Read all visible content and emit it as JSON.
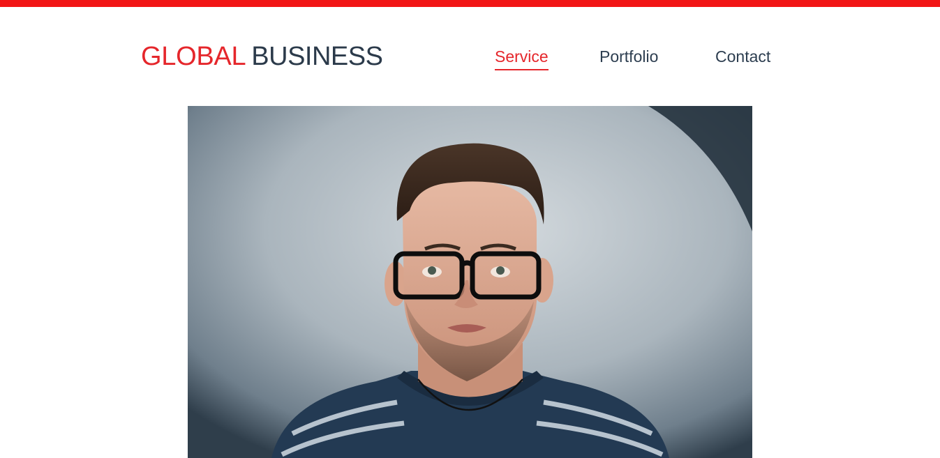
{
  "header": {
    "logo_light": "GLOBAL",
    "logo_strong": "BUSINESS",
    "nav": [
      {
        "label": "Service",
        "active": true
      },
      {
        "label": "Portfolio",
        "active": false
      },
      {
        "label": "Contact",
        "active": false
      }
    ]
  },
  "colors": {
    "accent": "#f21616",
    "brand_red": "#e5262b",
    "navy": "#2d3e50"
  },
  "hero": {
    "subject": "portrait of a young man with glasses and a striped navy sweater"
  }
}
